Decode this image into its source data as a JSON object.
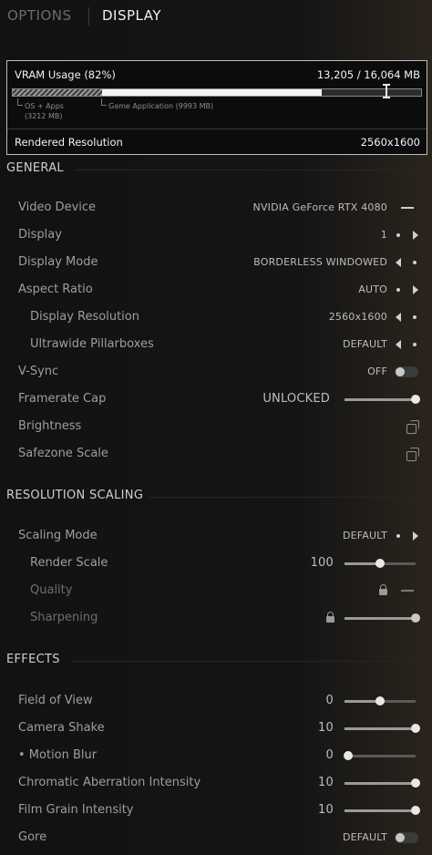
{
  "tabs": {
    "options": "OPTIONS",
    "display": "DISPLAY"
  },
  "vram": {
    "title": "VRAM Usage (82%)",
    "amount": "13,205 / 16,064 MB",
    "usage_fraction": 0.82,
    "os_label": "OS + Apps",
    "os_size": "(3212 MB)",
    "app_label": "Game Application (9993 MB)",
    "resolution_label": "Rendered Resolution",
    "resolution_value": "2560x1600"
  },
  "sections": {
    "general": "GENERAL",
    "resolution_scaling": "RESOLUTION SCALING",
    "effects": "EFFECTS"
  },
  "general": {
    "video_device": {
      "label": "Video Device",
      "value": "NVIDIA GeForce RTX 4080"
    },
    "display": {
      "label": "Display",
      "value": "1"
    },
    "display_mode": {
      "label": "Display Mode",
      "value": "BORDERLESS WINDOWED"
    },
    "aspect_ratio": {
      "label": "Aspect Ratio",
      "value": "AUTO"
    },
    "display_resolution": {
      "label": "Display Resolution",
      "value": "2560x1600"
    },
    "ultrawide_pillarboxes": {
      "label": "Ultrawide Pillarboxes",
      "value": "DEFAULT"
    },
    "vsync": {
      "label": "V-Sync",
      "value": "OFF"
    },
    "framerate_cap": {
      "label": "Framerate Cap",
      "value": "UNLOCKED",
      "level": 1.0
    },
    "brightness": {
      "label": "Brightness",
      "icon": "copy-icon"
    },
    "safezone_scale": {
      "label": "Safezone Scale",
      "icon": "copy-icon"
    }
  },
  "scaling": {
    "scaling_mode": {
      "label": "Scaling Mode",
      "value": "DEFAULT"
    },
    "render_scale": {
      "label": "Render Scale",
      "value": "100",
      "level": 0.5
    },
    "quality": {
      "label": "Quality",
      "icon": "lock-icon"
    },
    "sharpening": {
      "label": "Sharpening",
      "icon": "lock-icon",
      "level": 1.0
    }
  },
  "effects": {
    "field_of_view": {
      "label": "Field of View",
      "value": "0",
      "level": 0.5
    },
    "camera_shake": {
      "label": "Camera Shake",
      "value": "10",
      "level": 1.0
    },
    "motion_blur": {
      "label": "• Motion Blur",
      "value": "0",
      "level": 0.0
    },
    "chromatic_aberration": {
      "label": "Chromatic Aberration Intensity",
      "value": "10",
      "level": 1.0
    },
    "film_grain": {
      "label": "Film Grain Intensity",
      "value": "10",
      "level": 1.0
    },
    "gore": {
      "label": "Gore",
      "value": "DEFAULT"
    }
  }
}
